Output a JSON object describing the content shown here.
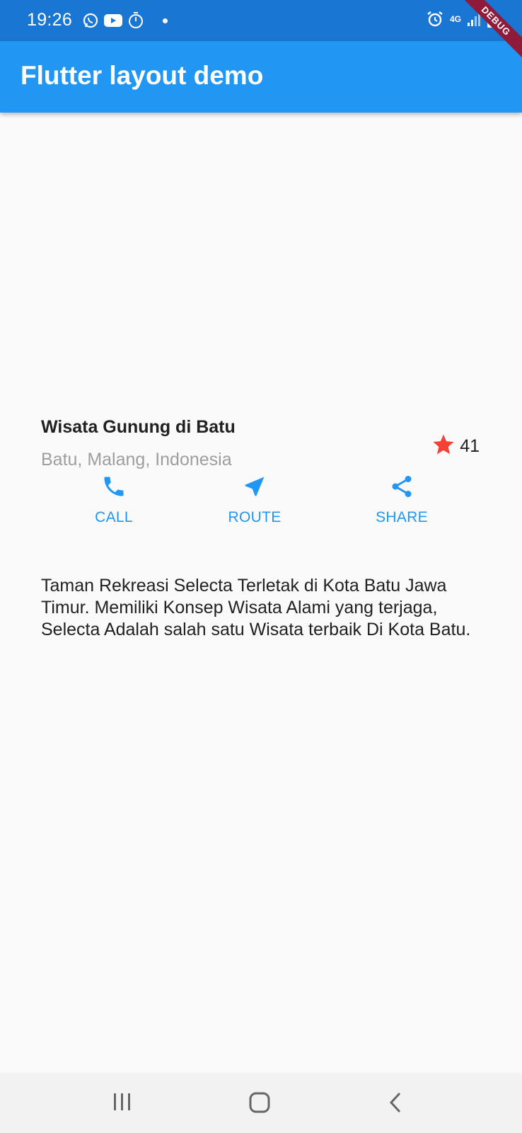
{
  "status_bar": {
    "time": "19:26",
    "network": "4G",
    "icons_left": [
      "whatsapp-icon",
      "youtube-icon",
      "timer-icon",
      "notification-dot"
    ],
    "icons_right": [
      "alarm-icon",
      "network-4g-icon",
      "signal-icon",
      "battery-icon"
    ]
  },
  "debug_banner": "DEBUG",
  "app_bar": {
    "title": "Flutter layout demo",
    "color": "#2196f3"
  },
  "title_section": {
    "title": "Wisata Gunung di Batu",
    "subtitle": "Batu, Malang, Indonesia",
    "rating_icon": "star-icon",
    "rating_color": "#f44336",
    "rating_count": "41"
  },
  "buttons": [
    {
      "icon": "phone-icon",
      "label": "CALL"
    },
    {
      "icon": "navigation-icon",
      "label": "ROUTE"
    },
    {
      "icon": "share-icon",
      "label": "SHARE"
    }
  ],
  "description": "Taman Rekreasi Selecta Terletak di Kota Batu Jawa Timur. Memiliki Konsep Wisata Alami yang terjaga, Selecta Adalah salah satu Wisata terbaik Di Kota Batu.",
  "nav_bar": {
    "icons": [
      "recent-apps-icon",
      "home-icon",
      "back-icon"
    ]
  },
  "colors": {
    "status_bar": "#1976d2",
    "accent": "#2196f3",
    "background": "#fafafa"
  }
}
